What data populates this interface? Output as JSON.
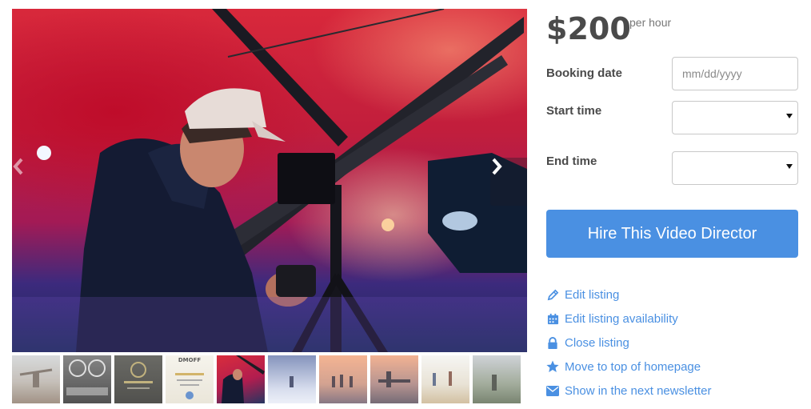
{
  "listing": {
    "price": "$200",
    "price_unit": "per hour"
  },
  "booking_form": {
    "date_label": "Booking date",
    "date_placeholder": "mm/dd/yyyy",
    "start_label": "Start time",
    "start_value": "",
    "end_label": "End time",
    "end_value": ""
  },
  "hire_button_label": "Hire This Video Director",
  "owner_actions": [
    {
      "label": "Edit listing",
      "icon": "pencil-icon"
    },
    {
      "label": "Edit listing availability",
      "icon": "calendar-icon"
    },
    {
      "label": "Close listing",
      "icon": "lock-icon"
    },
    {
      "label": "Move to top of homepage",
      "icon": "star-icon"
    },
    {
      "label": "Show in the next newsletter",
      "icon": "envelope-icon"
    }
  ],
  "gallery": {
    "active_index": 4,
    "thumbnail_texts": [
      "",
      "",
      "",
      "DMOFF",
      "",
      "",
      "",
      "",
      "",
      ""
    ]
  },
  "colors": {
    "accent": "#4a90e2",
    "text": "#4a4a4a",
    "muted": "#777777"
  }
}
